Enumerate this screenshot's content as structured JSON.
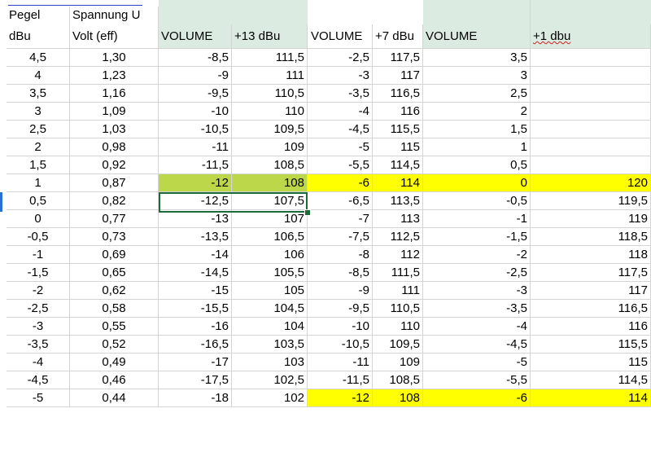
{
  "header": {
    "pegel": "Pegel",
    "dbu": "dBu",
    "spannung": "Spannung U",
    "volt": "Volt (eff)",
    "volume1": "VOLUME",
    "plus13": "+13 dBu",
    "volume2": "VOLUME",
    "plus7": "+7 dBu",
    "volume3": "VOLUME",
    "plus1": "+1 dbu"
  },
  "rows": [
    [
      "4,5",
      "1,30",
      "-8,5",
      "111,5",
      "-2,5",
      "117,5",
      "3,5",
      ""
    ],
    [
      "4",
      "1,23",
      "-9",
      "111",
      "-3",
      "117",
      "3",
      ""
    ],
    [
      "3,5",
      "1,16",
      "-9,5",
      "110,5",
      "-3,5",
      "116,5",
      "2,5",
      ""
    ],
    [
      "3",
      "1,09",
      "-10",
      "110",
      "-4",
      "116",
      "2",
      ""
    ],
    [
      "2,5",
      "1,03",
      "-10,5",
      "109,5",
      "-4,5",
      "115,5",
      "1,5",
      ""
    ],
    [
      "2",
      "0,98",
      "-11",
      "109",
      "-5",
      "115",
      "1",
      ""
    ],
    [
      "1,5",
      "0,92",
      "-11,5",
      "108,5",
      "-5,5",
      "114,5",
      "0,5",
      ""
    ],
    [
      "1",
      "0,87",
      "-12",
      "108",
      "-6",
      "114",
      "0",
      "120"
    ],
    [
      "0,5",
      "0,82",
      "-12,5",
      "107,5",
      "-6,5",
      "113,5",
      "-0,5",
      "119,5"
    ],
    [
      "0",
      "0,77",
      "-13",
      "107",
      "-7",
      "113",
      "-1",
      "119"
    ],
    [
      "-0,5",
      "0,73",
      "-13,5",
      "106,5",
      "-7,5",
      "112,5",
      "-1,5",
      "118,5"
    ],
    [
      "-1",
      "0,69",
      "-14",
      "106",
      "-8",
      "112",
      "-2",
      "118"
    ],
    [
      "-1,5",
      "0,65",
      "-14,5",
      "105,5",
      "-8,5",
      "111,5",
      "-2,5",
      "117,5"
    ],
    [
      "-2",
      "0,62",
      "-15",
      "105",
      "-9",
      "111",
      "-3",
      "117"
    ],
    [
      "-2,5",
      "0,58",
      "-15,5",
      "104,5",
      "-9,5",
      "110,5",
      "-3,5",
      "116,5"
    ],
    [
      "-3",
      "0,55",
      "-16",
      "104",
      "-10",
      "110",
      "-4",
      "116"
    ],
    [
      "-3,5",
      "0,52",
      "-16,5",
      "103,5",
      "-10,5",
      "109,5",
      "-4,5",
      "115,5"
    ],
    [
      "-4",
      "0,49",
      "-17",
      "103",
      "-11",
      "109",
      "-5",
      "115"
    ],
    [
      "-4,5",
      "0,46",
      "-17,5",
      "102,5",
      "-11,5",
      "108,5",
      "-5,5",
      "114,5"
    ],
    [
      "-5",
      "0,44",
      "-18",
      "102",
      "-12",
      "108",
      "-6",
      "114"
    ]
  ],
  "highlights": {
    "row_8": [
      "none",
      "none",
      "lime",
      "lime",
      "yellow",
      "yellow",
      "yellow",
      "yellow"
    ],
    "row_20": [
      "none",
      "none",
      "none",
      "none",
      "yellow",
      "yellow",
      "yellow",
      "yellow"
    ]
  },
  "colors": {
    "header_green": "#dcebe1",
    "highlight_yellow": "#ffff00",
    "selection_lime": "#bcd84a",
    "gridline": "#d4d4d4"
  }
}
